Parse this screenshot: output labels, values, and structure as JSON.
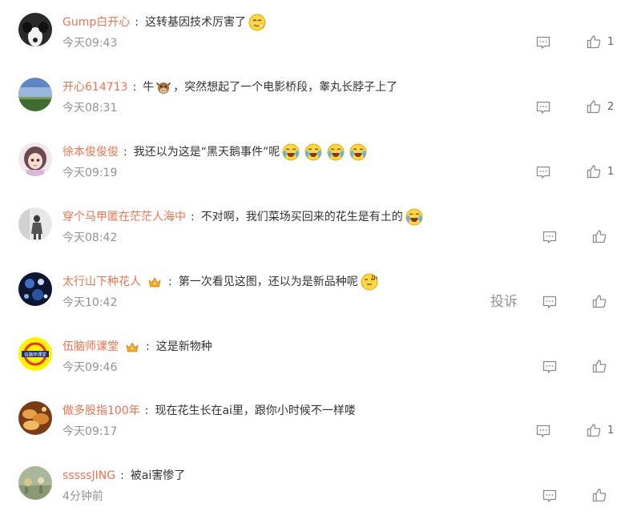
{
  "comments": [
    {
      "username": "Gump白开心",
      "text": "这转基因技术厉害了",
      "time": "今天09:43",
      "likes": "1",
      "avatar_icon": "dog-avatar",
      "emoji_icon": "cheeky-face-emoji"
    },
    {
      "username": "开心614713",
      "text_parts": [
        "牛",
        "，突然想起了一个电影桥段，睾丸长脖子上了"
      ],
      "time": "今天08:31",
      "likes": "2",
      "avatar_icon": "landscape-avatar",
      "emoji_icon": "cow-emoji"
    },
    {
      "username": "徐本俊俊俊",
      "text": "我还以为这是“黑天鹅事件”呢",
      "time": "今天09:19",
      "likes": "1",
      "avatar_icon": "girl-avatar",
      "emoji_icon": "laugh-cry-emoji"
    },
    {
      "username": "穿个马甲匿在茫茫人海中",
      "text": "不对啊，我们菜场买回来的花生是有土的",
      "time": "今天08:42",
      "avatar_icon": "figure-avatar",
      "emoji_icon": "laugh-cry-emoji"
    },
    {
      "username": "太行山下种花人",
      "text": "第一次看见这图，还以为是新品种呢",
      "time": "今天10:42",
      "report_label": "投诉",
      "avatar_icon": "planets-avatar",
      "emoji_icon": "doh-face-emoji"
    },
    {
      "username": "伍脑师课堂",
      "text": "这是新物种",
      "time": "今天09:46",
      "avatar_icon": "brand-avatar",
      "avatar_label": "伍脑师课堂"
    },
    {
      "username": "做多股指100年",
      "text": "现在花生长在ai里，跟你小时候不一样喽",
      "time": "今天09:17",
      "likes": "1",
      "avatar_icon": "food-avatar"
    },
    {
      "username": "sssssJING",
      "text": "被ai害惨了",
      "time": "4分钟前",
      "avatar_icon": "painting-avatar"
    }
  ],
  "colors": {
    "username": "#eb7350",
    "text": "#333333",
    "meta": "#939393"
  }
}
